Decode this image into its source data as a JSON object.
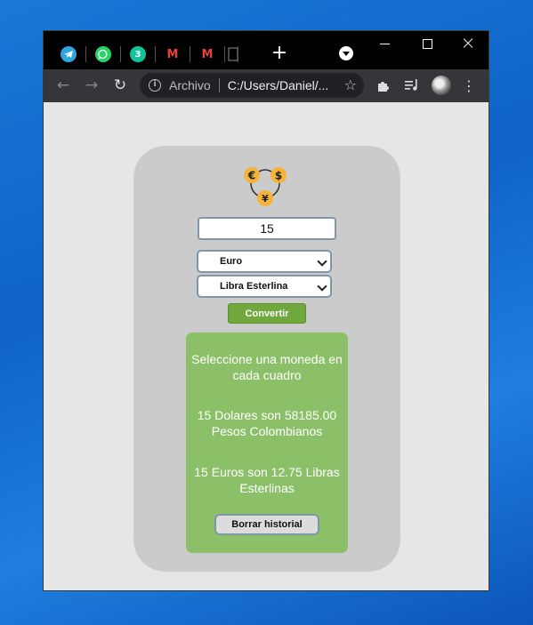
{
  "browser": {
    "tabs": [
      {
        "icon": "telegram-icon",
        "color": "#2ca5e0"
      },
      {
        "icon": "whatsapp-icon",
        "color": "#25d366"
      },
      {
        "icon": "grammarly-icon",
        "color": "#15c39a",
        "glyph": "3"
      },
      {
        "icon": "gmail-icon",
        "color": "#ea4335",
        "glyph": "M"
      },
      {
        "icon": "gmail-icon",
        "color": "#ea4335",
        "glyph": "M"
      },
      {
        "icon": "document-icon",
        "color": "#777777"
      }
    ],
    "new_tab": "+",
    "address_label": "Archivo",
    "address_url": "C:/Users/Daniel/..."
  },
  "app": {
    "amount_value": "15",
    "from_currency": "Euro",
    "to_currency": "Libra Esterlina",
    "convert_label": "Convertir",
    "history": [
      "Seleccione una moneda en cada cuadro",
      "15 Dolares son 58185.00 Pesos Colombianos",
      "15 Euros son 12.75 Libras Esterlinas"
    ],
    "clear_label": "Borrar historial",
    "logo_symbols": {
      "euro": "€",
      "dollar": "$",
      "yen": "¥"
    },
    "colors": {
      "accent_green": "#71a83e",
      "panel_green": "#8cc068",
      "coin": "#f4b43a"
    }
  }
}
